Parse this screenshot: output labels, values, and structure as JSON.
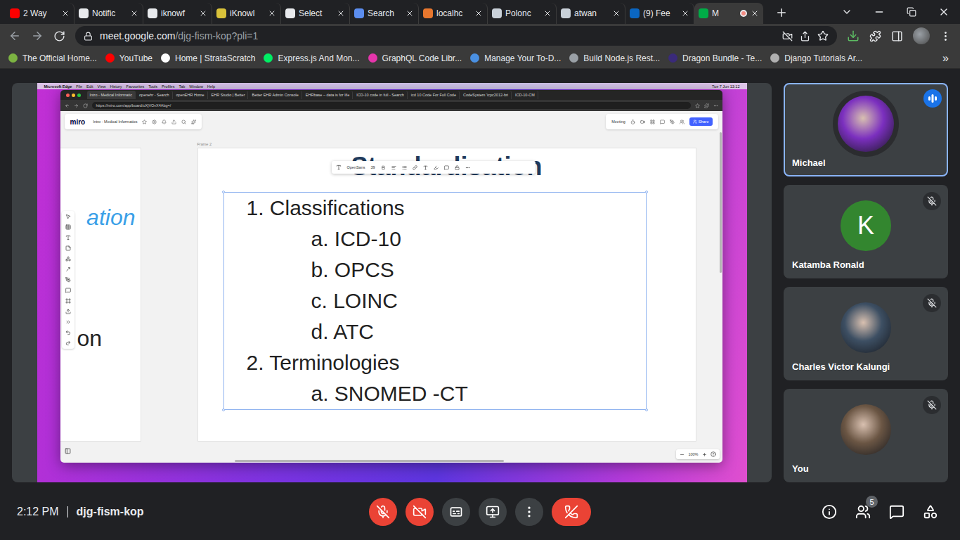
{
  "browser": {
    "tabs": [
      {
        "label": "2 Way",
        "selected": false,
        "recording": false,
        "color": "#ff0000"
      },
      {
        "label": "Notific",
        "selected": false,
        "recording": false,
        "color": "#e8eaed"
      },
      {
        "label": "iknowf",
        "selected": false,
        "recording": false,
        "color": "#e8eaed"
      },
      {
        "label": "iKnowl",
        "selected": false,
        "recording": false,
        "color": "#d9c23a"
      },
      {
        "label": "Select",
        "selected": false,
        "recording": false,
        "color": "#e8eaed"
      },
      {
        "label": "Search",
        "selected": false,
        "recording": false,
        "color": "#5b8def"
      },
      {
        "label": "localhc",
        "selected": false,
        "recording": false,
        "color": "#e8772e"
      },
      {
        "label": "Polonc",
        "selected": false,
        "recording": false,
        "color": "#c9d1d9"
      },
      {
        "label": "atwan",
        "selected": false,
        "recording": false,
        "color": "#c9d1d9"
      },
      {
        "label": "(9) Fee",
        "selected": false,
        "recording": false,
        "color": "#0a66c2"
      },
      {
        "label": "M",
        "selected": true,
        "recording": true,
        "color": "#00ac47"
      }
    ],
    "address": {
      "host": "meet.google.com",
      "path": "/djg-fism-kop?pli=1"
    },
    "bookmarks": [
      {
        "label": "The Official Home...",
        "color": "#7cb342"
      },
      {
        "label": "YouTube",
        "color": "#ff0000"
      },
      {
        "label": "Home | StrataScratch",
        "color": "#ffffff"
      },
      {
        "label": "Express.js And Mon...",
        "color": "#00ed64"
      },
      {
        "label": "GraphQL Code Libr...",
        "color": "#e535ab"
      },
      {
        "label": "Manage Your To-D...",
        "color": "#4a90e2"
      },
      {
        "label": "Build Node.js Rest...",
        "color": "#9aa0a6"
      },
      {
        "label": "Dragon Bundle - Te...",
        "color": "#3a2a7a"
      },
      {
        "label": "Django Tutorials Ar...",
        "color": "#b0b0b0"
      }
    ],
    "bookmarks_overflow": "»"
  },
  "shared_screen": {
    "menubar": {
      "app": "Microsoft Edge",
      "items": [
        "File",
        "Edit",
        "View",
        "History",
        "Favourites",
        "Tools",
        "Profiles",
        "Tab",
        "Window",
        "Help"
      ],
      "clock": "Tue 7 Jun 13:12"
    },
    "tabs": [
      {
        "label": "Intro - Medical Informatic",
        "selected": true
      },
      {
        "label": "openehr - Search",
        "selected": false
      },
      {
        "label": "openEHR Home",
        "selected": false
      },
      {
        "label": "EHR Studio | Better",
        "selected": false
      },
      {
        "label": "Better EHR Admin Console",
        "selected": false
      },
      {
        "label": "EHRbase – data is for life",
        "selected": false
      },
      {
        "label": "ICD-10 code in full - Search",
        "selected": false
      },
      {
        "label": "icd 10 Code For Full Code",
        "selected": false
      },
      {
        "label": "CodeSystem 'icpc2012-bri",
        "selected": false
      },
      {
        "label": "ICD-10-CM",
        "selected": false
      }
    ],
    "url": "https://miro.com/app/board/uXjVOvX4Abg=/",
    "miro": {
      "logo": "miro",
      "board": "Intro - Medical Informatics",
      "meeting": "Meeting",
      "share": "Share",
      "zoom": "100%",
      "frame_label": "Frame 2",
      "side_frame": {
        "lines": [
          {
            "text": "ation",
            "kind": "heading"
          },
          {
            "text": "on",
            "kind": "body"
          }
        ]
      },
      "frame": {
        "title": "Standardisation",
        "text_toolbar": {
          "font": "OpenSans",
          "size": "39"
        },
        "list": [
          {
            "indent": 0,
            "text": "1. Classifications"
          },
          {
            "indent": 1,
            "text": "a. ICD-10"
          },
          {
            "indent": 1,
            "text": "b. OPCS"
          },
          {
            "indent": 1,
            "text": "c. LOINC"
          },
          {
            "indent": 1,
            "text": "d. ATC"
          },
          {
            "indent": 0,
            "text": "2. Terminologies"
          },
          {
            "indent": 1,
            "text": "a. SNOMED -CT"
          }
        ]
      }
    }
  },
  "participants": [
    {
      "name": "Michael",
      "speaking": true,
      "muted": false,
      "avatar": {
        "kind": "photo",
        "initial": "",
        "color": "#7b2fbf"
      }
    },
    {
      "name": "Katamba Ronald",
      "speaking": false,
      "muted": true,
      "avatar": {
        "kind": "initial",
        "initial": "K",
        "color": "#33862f"
      }
    },
    {
      "name": "Charles Victor Kalungi",
      "speaking": false,
      "muted": true,
      "avatar": {
        "kind": "photo",
        "initial": "",
        "color": "#3d4f63"
      }
    },
    {
      "name": "You",
      "speaking": false,
      "muted": true,
      "avatar": {
        "kind": "photo",
        "initial": "",
        "color": "#6b5644"
      }
    }
  ],
  "bottom_bar": {
    "time": "2:12 PM",
    "meeting_code": "djg-fism-kop",
    "controls": [
      {
        "kind": "mic",
        "on": false
      },
      {
        "kind": "camera",
        "on": false
      },
      {
        "kind": "captions",
        "on": false
      },
      {
        "kind": "present",
        "on": false
      },
      {
        "kind": "more",
        "on": false
      },
      {
        "kind": "leave",
        "on": false
      }
    ],
    "side": [
      {
        "kind": "info",
        "badge": ""
      },
      {
        "kind": "people",
        "badge": "5"
      },
      {
        "kind": "chat",
        "badge": ""
      },
      {
        "kind": "activities",
        "badge": ""
      }
    ]
  }
}
